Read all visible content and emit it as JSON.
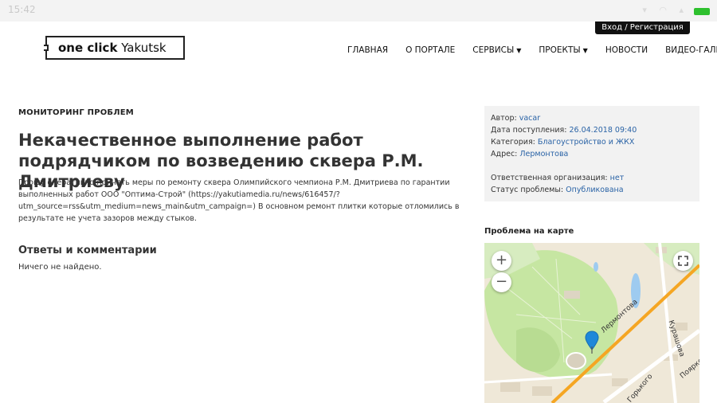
{
  "status": {
    "time": "15:42"
  },
  "header": {
    "login_label": "Вход / Регистрация",
    "logo": {
      "bold": "one click",
      "light": "Yakutsk"
    },
    "nav": [
      {
        "label": "ГЛАВНАЯ",
        "dropdown": false
      },
      {
        "label": "О ПОРТАЛЕ",
        "dropdown": false
      },
      {
        "label": "СЕРВИСЫ",
        "dropdown": true
      },
      {
        "label": "ПРОЕКТЫ",
        "dropdown": true
      },
      {
        "label": "НОВОСТИ",
        "dropdown": false
      },
      {
        "label": "ВИДЕО-ГАЛЕРЕЯ",
        "dropdown": false
      }
    ]
  },
  "main": {
    "section_label": "МОНИТОРИНГ ПРОБЛЕМ",
    "title": "Некачественное выполнение работ подрядчиком по возведению сквера Р.М. Дмитриеву",
    "description": "Прошу оперативно принять меры по ремонту сквера Олимпийского чемпиона Р.М. Дмитриева по гарантии выполненных работ ООО \"Оптима-Строй\" (https://yakutiamedia.ru/news/616457/?utm_source=rss&utm_medium=news_main&utm_campaign=) В основном ремонт плитки которые отломились в результате не учета зазоров между стыков.",
    "comments_title": "Ответы и комментарии",
    "comments_empty": "Ничего не найдено."
  },
  "info": {
    "author_label": "Автор:",
    "author": "vacar",
    "date_label": "Дата поступления:",
    "date": "26.04.2018 09:40",
    "category_label": "Категория:",
    "category": "Благоустройство и ЖКХ",
    "address_label": "Адрес:",
    "address": "Лермонтова",
    "org_label": "Ответственная организация:",
    "org": "нет",
    "status_label": "Статус проблемы:",
    "status": "Опубликована"
  },
  "map": {
    "title": "Проблема на карте",
    "zoom_in": "+",
    "zoom_out": "−",
    "streets": {
      "lermontova": "Лермонтова",
      "kurashova": "Курашова",
      "poyarkova": "Поярков",
      "gorkogo": "Горького"
    },
    "colors": {
      "road": "#f5a623",
      "park": "#c6e6a2",
      "water": "#9ecbf0",
      "marker": "#1e88d9"
    }
  }
}
